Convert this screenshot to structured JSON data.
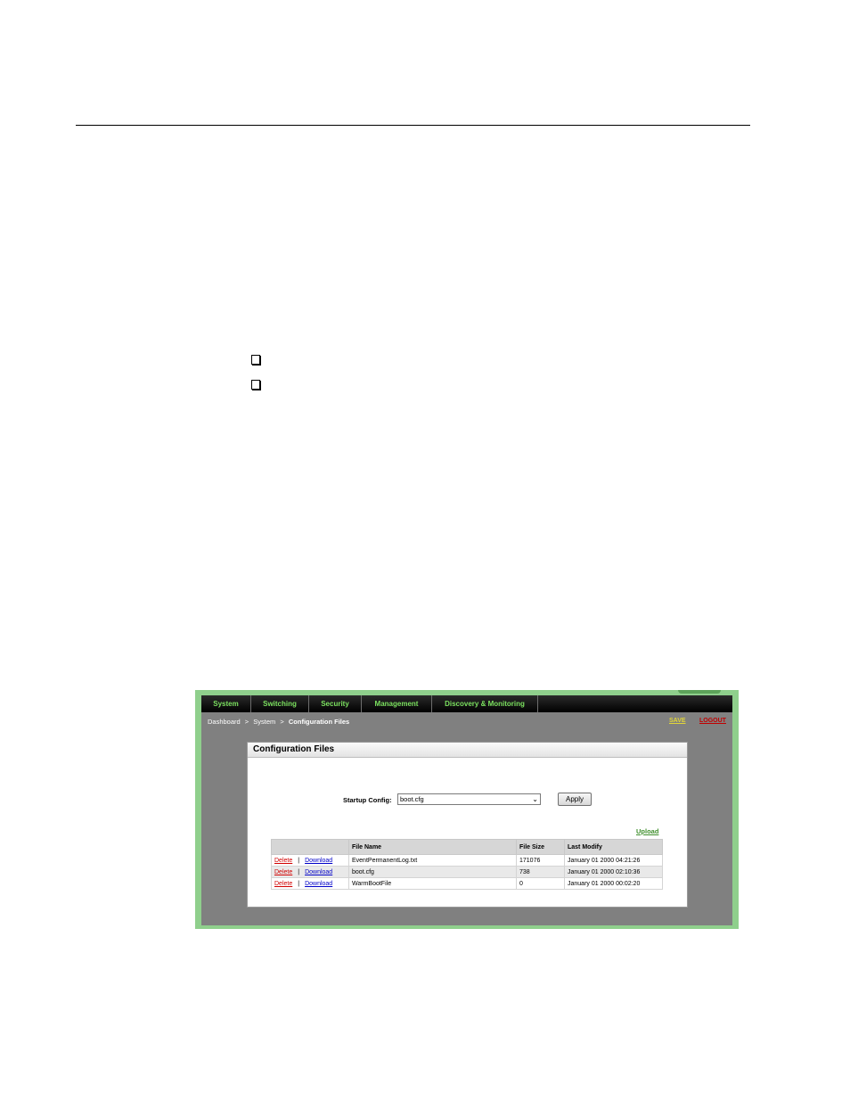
{
  "document": {
    "bullets": [
      "",
      ""
    ]
  },
  "ui": {
    "nav": {
      "items": [
        "System",
        "Switching",
        "Security",
        "Management",
        "Discovery & Monitoring"
      ]
    },
    "breadcrumb": {
      "items": [
        "Dashboard",
        "System",
        "Configuration Files"
      ],
      "separator": ">"
    },
    "actions": {
      "save": "SAVE",
      "logout": "LOGOUT"
    },
    "panel": {
      "title": "Configuration Files",
      "startup_label": "Startup Config:",
      "startup_value": "boot.cfg",
      "apply_label": "Apply",
      "upload_label": "Upload"
    },
    "table": {
      "headers": [
        "",
        "File Name",
        "File Size",
        "Last Modify"
      ],
      "delete_label": "Delete",
      "download_label": "Download",
      "rows": [
        {
          "name": "EventPermanentLog.txt",
          "size": "171076",
          "modified": "January 01 2000 04:21:26"
        },
        {
          "name": "boot.cfg",
          "size": "738",
          "modified": "January 01 2000 02:10:36"
        },
        {
          "name": "WarmBootFile",
          "size": "0",
          "modified": "January 01 2000 00:02:20"
        }
      ]
    },
    "colors": {
      "frame": "#8fcf8c",
      "nav_text": "#7be05f",
      "save": "#e0d43a",
      "logout": "#c00000",
      "delete": "#d10000",
      "download": "#0000c8",
      "upload": "#3f8f2c"
    }
  }
}
